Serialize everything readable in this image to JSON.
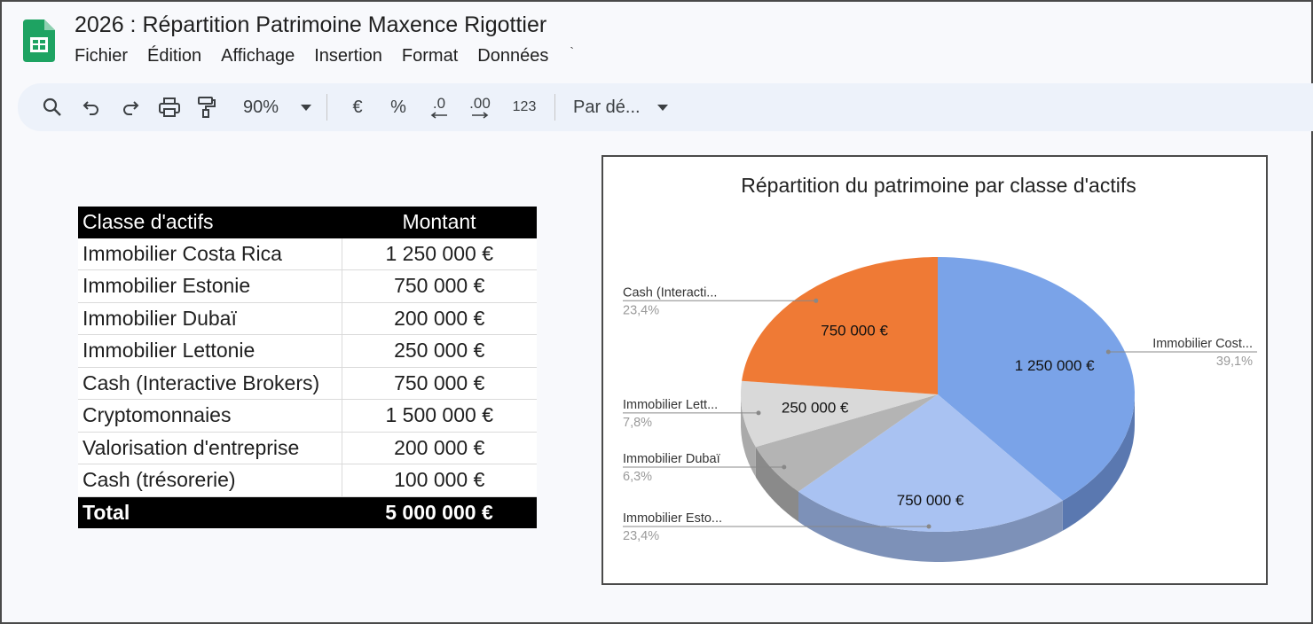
{
  "app": {
    "doc_title": "2026 : Répartition Patrimoine Maxence Rigottier",
    "menu": [
      "Fichier",
      "Édition",
      "Affichage",
      "Insertion",
      "Format",
      "Données"
    ],
    "menu_more": "`"
  },
  "toolbar": {
    "zoom": "90%",
    "currency": "€",
    "percent": "%",
    "decrease_decimals": ".0",
    "increase_decimals": ".00",
    "number_format": "123",
    "font": "Par dé..."
  },
  "table": {
    "headers": [
      "Classe d'actifs",
      "Montant"
    ],
    "rows": [
      [
        "Immobilier Costa Rica",
        "1 250 000 €"
      ],
      [
        "Immobilier Estonie",
        "750 000 €"
      ],
      [
        "Immobilier Dubaï",
        "200 000 €"
      ],
      [
        "Immobilier Lettonie",
        "250 000 €"
      ],
      [
        "Cash (Interactive Brokers)",
        "750 000 €"
      ],
      [
        "Cryptomonnaies",
        "1 500 000 €"
      ],
      [
        "Valorisation d'entreprise",
        "200 000 €"
      ],
      [
        "Cash (trésorerie)",
        "100 000 €"
      ]
    ],
    "total": [
      "Total",
      "5 000 000 €"
    ]
  },
  "chart_data": {
    "type": "pie",
    "title": "Répartition du patrimoine par classe d'actifs",
    "slices": [
      {
        "label": "Immobilier Cost...",
        "value": 1250000,
        "value_label": "1 250 000 €",
        "percent": "39,1%",
        "color": "#7aa3e8",
        "side_color": "#5a78b0"
      },
      {
        "label": "Immobilier Esto...",
        "value": 750000,
        "value_label": "750 000 €",
        "percent": "23,4%",
        "color": "#a9c2f2",
        "side_color": "#7d91b8"
      },
      {
        "label": "Immobilier Dubaï",
        "value": 200000,
        "value_label": "",
        "percent": "6,3%",
        "color": "#b4b4b4",
        "side_color": "#8a8a8a"
      },
      {
        "label": "Immobilier Lett...",
        "value": 250000,
        "value_label": "250 000 €",
        "percent": "7,8%",
        "color": "#d9d9d9",
        "side_color": "#aaaaaa"
      },
      {
        "label": "Cash (Interacti...",
        "value": 750000,
        "value_label": "750 000 €",
        "percent": "23,4%",
        "color": "#ef7a35",
        "side_color": "#b85c25"
      }
    ],
    "legend": "none"
  }
}
